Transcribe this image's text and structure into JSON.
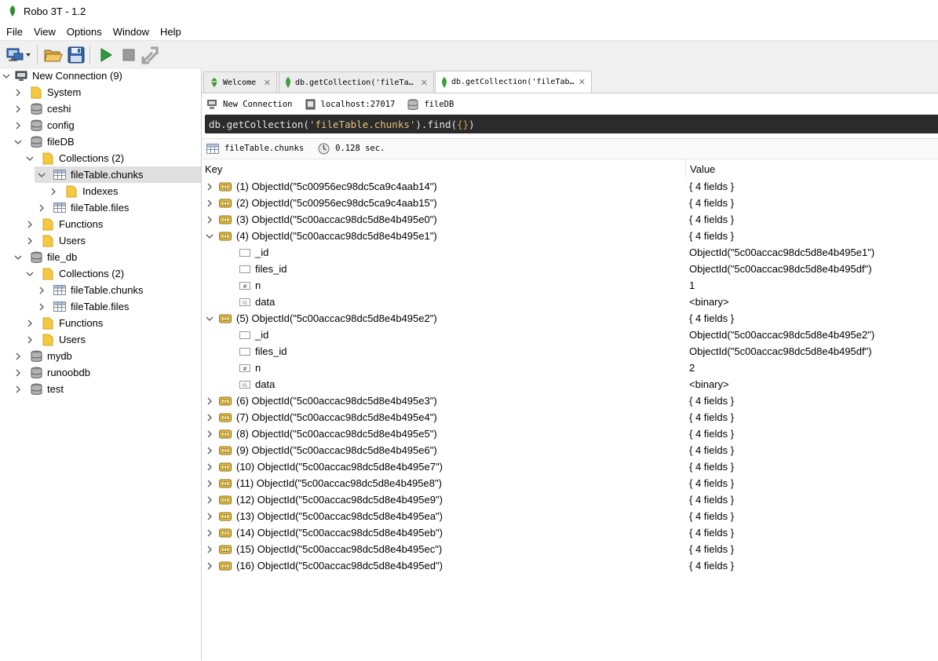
{
  "window": {
    "title": "Robo 3T - 1.2"
  },
  "menu": [
    "File",
    "View",
    "Options",
    "Window",
    "Help"
  ],
  "toolbar": {
    "buttons": [
      "connect-icon",
      "open-icon",
      "save-icon",
      "execute-icon",
      "stop-icon",
      "explain-icon"
    ]
  },
  "colors": {
    "folder": "#f5c842",
    "query_bg": "#2b2b2b",
    "accent_green": "#2e8b2e"
  },
  "sidebar": {
    "connection": "New Connection (9)",
    "items": [
      {
        "label": "System",
        "type": "folder"
      },
      {
        "label": "ceshi",
        "type": "db"
      },
      {
        "label": "config",
        "type": "db"
      },
      {
        "label": "fileDB",
        "type": "db"
      },
      {
        "label": "Collections (2)",
        "type": "folder"
      },
      {
        "label": "fileTable.chunks",
        "type": "collection"
      },
      {
        "label": "Indexes",
        "type": "folder"
      },
      {
        "label": "fileTable.files",
        "type": "collection"
      },
      {
        "label": "Functions",
        "type": "folder"
      },
      {
        "label": "Users",
        "type": "folder"
      },
      {
        "label": "file_db",
        "type": "db"
      },
      {
        "label": "Collections (2)",
        "type": "folder"
      },
      {
        "label": "fileTable.chunks",
        "type": "collection"
      },
      {
        "label": "fileTable.files",
        "type": "collection"
      },
      {
        "label": "Functions",
        "type": "folder"
      },
      {
        "label": "Users",
        "type": "folder"
      },
      {
        "label": "mydb",
        "type": "db"
      },
      {
        "label": "runoobdb",
        "type": "db"
      },
      {
        "label": "test",
        "type": "db"
      }
    ]
  },
  "tabs": [
    {
      "label": "Welcome",
      "icon": "robo-icon"
    },
    {
      "label": "db.getCollection('fileTa…",
      "icon": "mongo-leaf-icon"
    },
    {
      "label": "db.getCollection('fileTab…",
      "icon": "mongo-leaf-icon"
    }
  ],
  "info": {
    "connection": "New Connection",
    "host": "localhost:27017",
    "db": "fileDB"
  },
  "query": {
    "prefix": "db.getCollection(",
    "arg": "'fileTable.chunks'",
    "mid": ").find(",
    "braces": "{}",
    "suffix": ")"
  },
  "result": {
    "collection": "fileTable.chunks",
    "time": "0.128 sec."
  },
  "grid": {
    "key_header": "Key",
    "value_header": "Value",
    "rows": [
      {
        "key": "(1) ObjectId(\"5c00956ec98dc5ca9c4aab14\")",
        "value": "{ 4 fields }",
        "level": 0,
        "expanded": false,
        "icon": "doc"
      },
      {
        "key": "(2) ObjectId(\"5c00956ec98dc5ca9c4aab15\")",
        "value": "{ 4 fields }",
        "level": 0,
        "expanded": false,
        "icon": "doc"
      },
      {
        "key": "(3) ObjectId(\"5c00accac98dc5d8e4b495e0\")",
        "value": "{ 4 fields }",
        "level": 0,
        "expanded": false,
        "icon": "doc"
      },
      {
        "key": "(4) ObjectId(\"5c00accac98dc5d8e4b495e1\")",
        "value": "{ 4 fields }",
        "level": 0,
        "expanded": true,
        "icon": "doc"
      },
      {
        "key": "_id",
        "value": "ObjectId(\"5c00accac98dc5d8e4b495e1\")",
        "level": 1,
        "icon": "field"
      },
      {
        "key": "files_id",
        "value": "ObjectId(\"5c00accac98dc5d8e4b495df\")",
        "level": 1,
        "icon": "field"
      },
      {
        "key": "n",
        "value": "1",
        "level": 1,
        "icon": "number"
      },
      {
        "key": "data",
        "value": "<binary>",
        "level": 1,
        "icon": "binary"
      },
      {
        "key": "(5) ObjectId(\"5c00accac98dc5d8e4b495e2\")",
        "value": "{ 4 fields }",
        "level": 0,
        "expanded": true,
        "icon": "doc"
      },
      {
        "key": "_id",
        "value": "ObjectId(\"5c00accac98dc5d8e4b495e2\")",
        "level": 1,
        "icon": "field"
      },
      {
        "key": "files_id",
        "value": "ObjectId(\"5c00accac98dc5d8e4b495df\")",
        "level": 1,
        "icon": "field"
      },
      {
        "key": "n",
        "value": "2",
        "level": 1,
        "icon": "number"
      },
      {
        "key": "data",
        "value": "<binary>",
        "level": 1,
        "icon": "binary"
      },
      {
        "key": "(6) ObjectId(\"5c00accac98dc5d8e4b495e3\")",
        "value": "{ 4 fields }",
        "level": 0,
        "expanded": false,
        "icon": "doc"
      },
      {
        "key": "(7) ObjectId(\"5c00accac98dc5d8e4b495e4\")",
        "value": "{ 4 fields }",
        "level": 0,
        "expanded": false,
        "icon": "doc"
      },
      {
        "key": "(8) ObjectId(\"5c00accac98dc5d8e4b495e5\")",
        "value": "{ 4 fields }",
        "level": 0,
        "expanded": false,
        "icon": "doc"
      },
      {
        "key": "(9) ObjectId(\"5c00accac98dc5d8e4b495e6\")",
        "value": "{ 4 fields }",
        "level": 0,
        "expanded": false,
        "icon": "doc"
      },
      {
        "key": "(10) ObjectId(\"5c00accac98dc5d8e4b495e7\")",
        "value": "{ 4 fields }",
        "level": 0,
        "expanded": false,
        "icon": "doc"
      },
      {
        "key": "(11) ObjectId(\"5c00accac98dc5d8e4b495e8\")",
        "value": "{ 4 fields }",
        "level": 0,
        "expanded": false,
        "icon": "doc"
      },
      {
        "key": "(12) ObjectId(\"5c00accac98dc5d8e4b495e9\")",
        "value": "{ 4 fields }",
        "level": 0,
        "expanded": false,
        "icon": "doc"
      },
      {
        "key": "(13) ObjectId(\"5c00accac98dc5d8e4b495ea\")",
        "value": "{ 4 fields }",
        "level": 0,
        "expanded": false,
        "icon": "doc"
      },
      {
        "key": "(14) ObjectId(\"5c00accac98dc5d8e4b495eb\")",
        "value": "{ 4 fields }",
        "level": 0,
        "expanded": false,
        "icon": "doc"
      },
      {
        "key": "(15) ObjectId(\"5c00accac98dc5d8e4b495ec\")",
        "value": "{ 4 fields }",
        "level": 0,
        "expanded": false,
        "icon": "doc"
      },
      {
        "key": "(16) ObjectId(\"5c00accac98dc5d8e4b495ed\")",
        "value": "{ 4 fields }",
        "level": 0,
        "expanded": false,
        "icon": "doc"
      }
    ]
  }
}
